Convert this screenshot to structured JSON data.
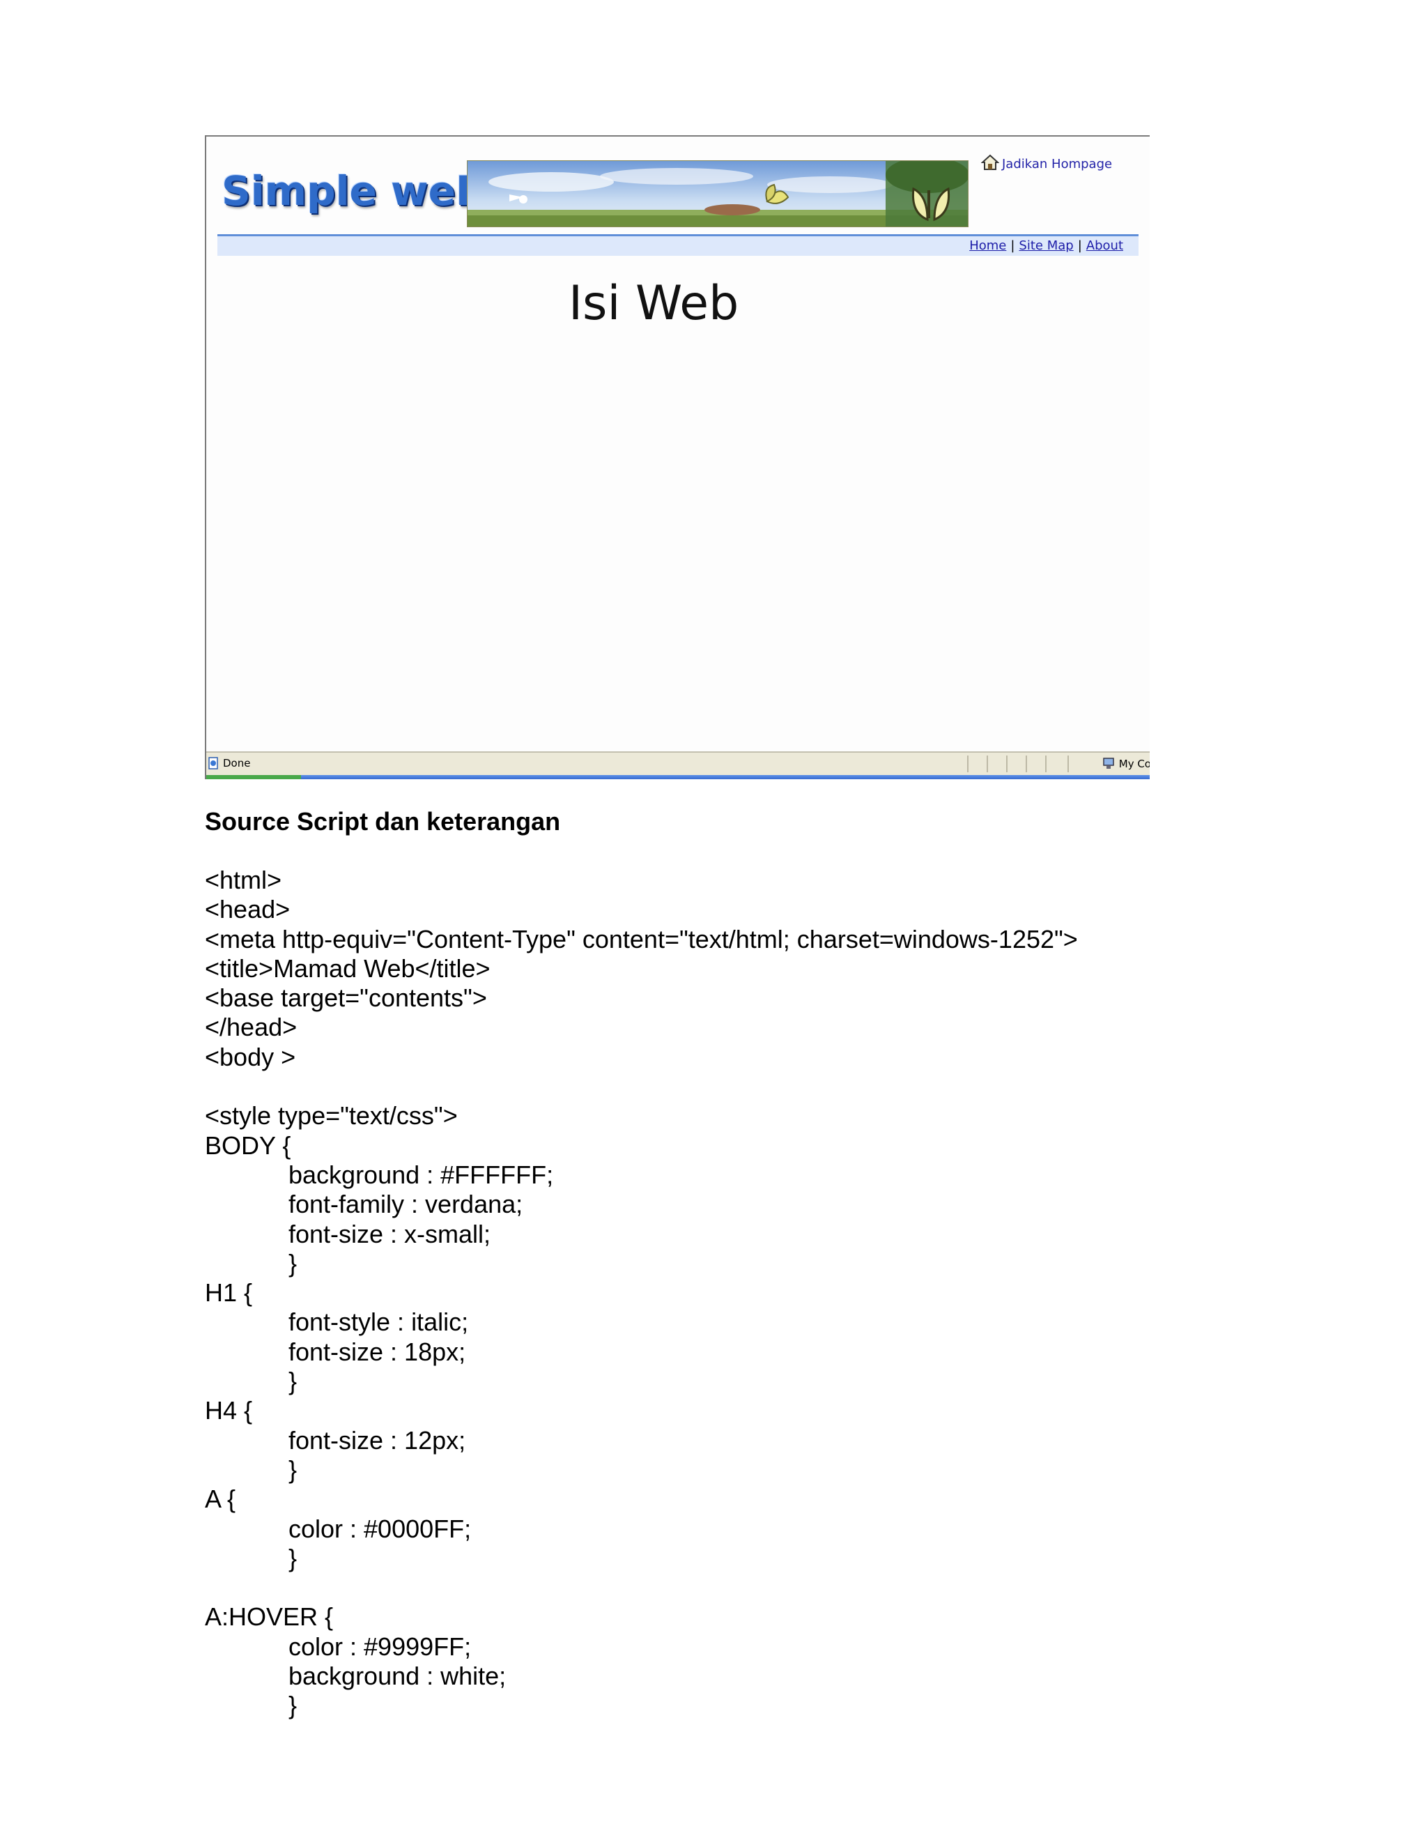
{
  "browser": {
    "logo_text": "Simple weB",
    "home_link": "Jadikan Hompage",
    "nav": [
      "Home",
      "Site Map",
      "About"
    ],
    "nav_separator": "|",
    "content_title": "Isi Web",
    "status_text": "Done",
    "zone_text": "My Co"
  },
  "doc": {
    "heading": "Source Script dan keterangan",
    "code_lines": [
      {
        "text": "<html>",
        "indent": false
      },
      {
        "text": "<head>",
        "indent": false
      },
      {
        "text": "<meta http-equiv=\"Content-Type\" content=\"text/html; charset=windows-1252\">",
        "indent": false
      },
      {
        "text": "<title>Mamad Web</title>",
        "indent": false
      },
      {
        "text": "<base target=\"contents\">",
        "indent": false
      },
      {
        "text": "</head>",
        "indent": false
      },
      {
        "text": "<body >",
        "indent": false
      },
      {
        "text": "",
        "indent": false
      },
      {
        "text": "<style type=\"text/css\">",
        "indent": false
      },
      {
        "text": "BODY {",
        "indent": false
      },
      {
        "text": "background : #FFFFFF;",
        "indent": true
      },
      {
        "text": "font-family : verdana;",
        "indent": true
      },
      {
        "text": "font-size : x-small;",
        "indent": true
      },
      {
        "text": "}",
        "indent": true
      },
      {
        "text": "H1 {",
        "indent": false
      },
      {
        "text": "font-style : italic;",
        "indent": true
      },
      {
        "text": "font-size : 18px;",
        "indent": true
      },
      {
        "text": "}",
        "indent": true
      },
      {
        "text": "H4 {",
        "indent": false
      },
      {
        "text": "font-size : 12px;",
        "indent": true
      },
      {
        "text": "}",
        "indent": true
      },
      {
        "text": "A {",
        "indent": false
      },
      {
        "text": "color : #0000FF;",
        "indent": true
      },
      {
        "text": "}",
        "indent": true
      },
      {
        "text": "",
        "indent": false
      },
      {
        "text": "A:HOVER {",
        "indent": false
      },
      {
        "text": "color : #9999FF;",
        "indent": true
      },
      {
        "text": "background : white;",
        "indent": true
      },
      {
        "text": "}",
        "indent": true
      }
    ]
  },
  "colors": {
    "link": "#1d1da8",
    "navbar_bg": "#dde8fb",
    "navbar_border": "#5f8ed8",
    "logo": "#2f6bc9"
  }
}
